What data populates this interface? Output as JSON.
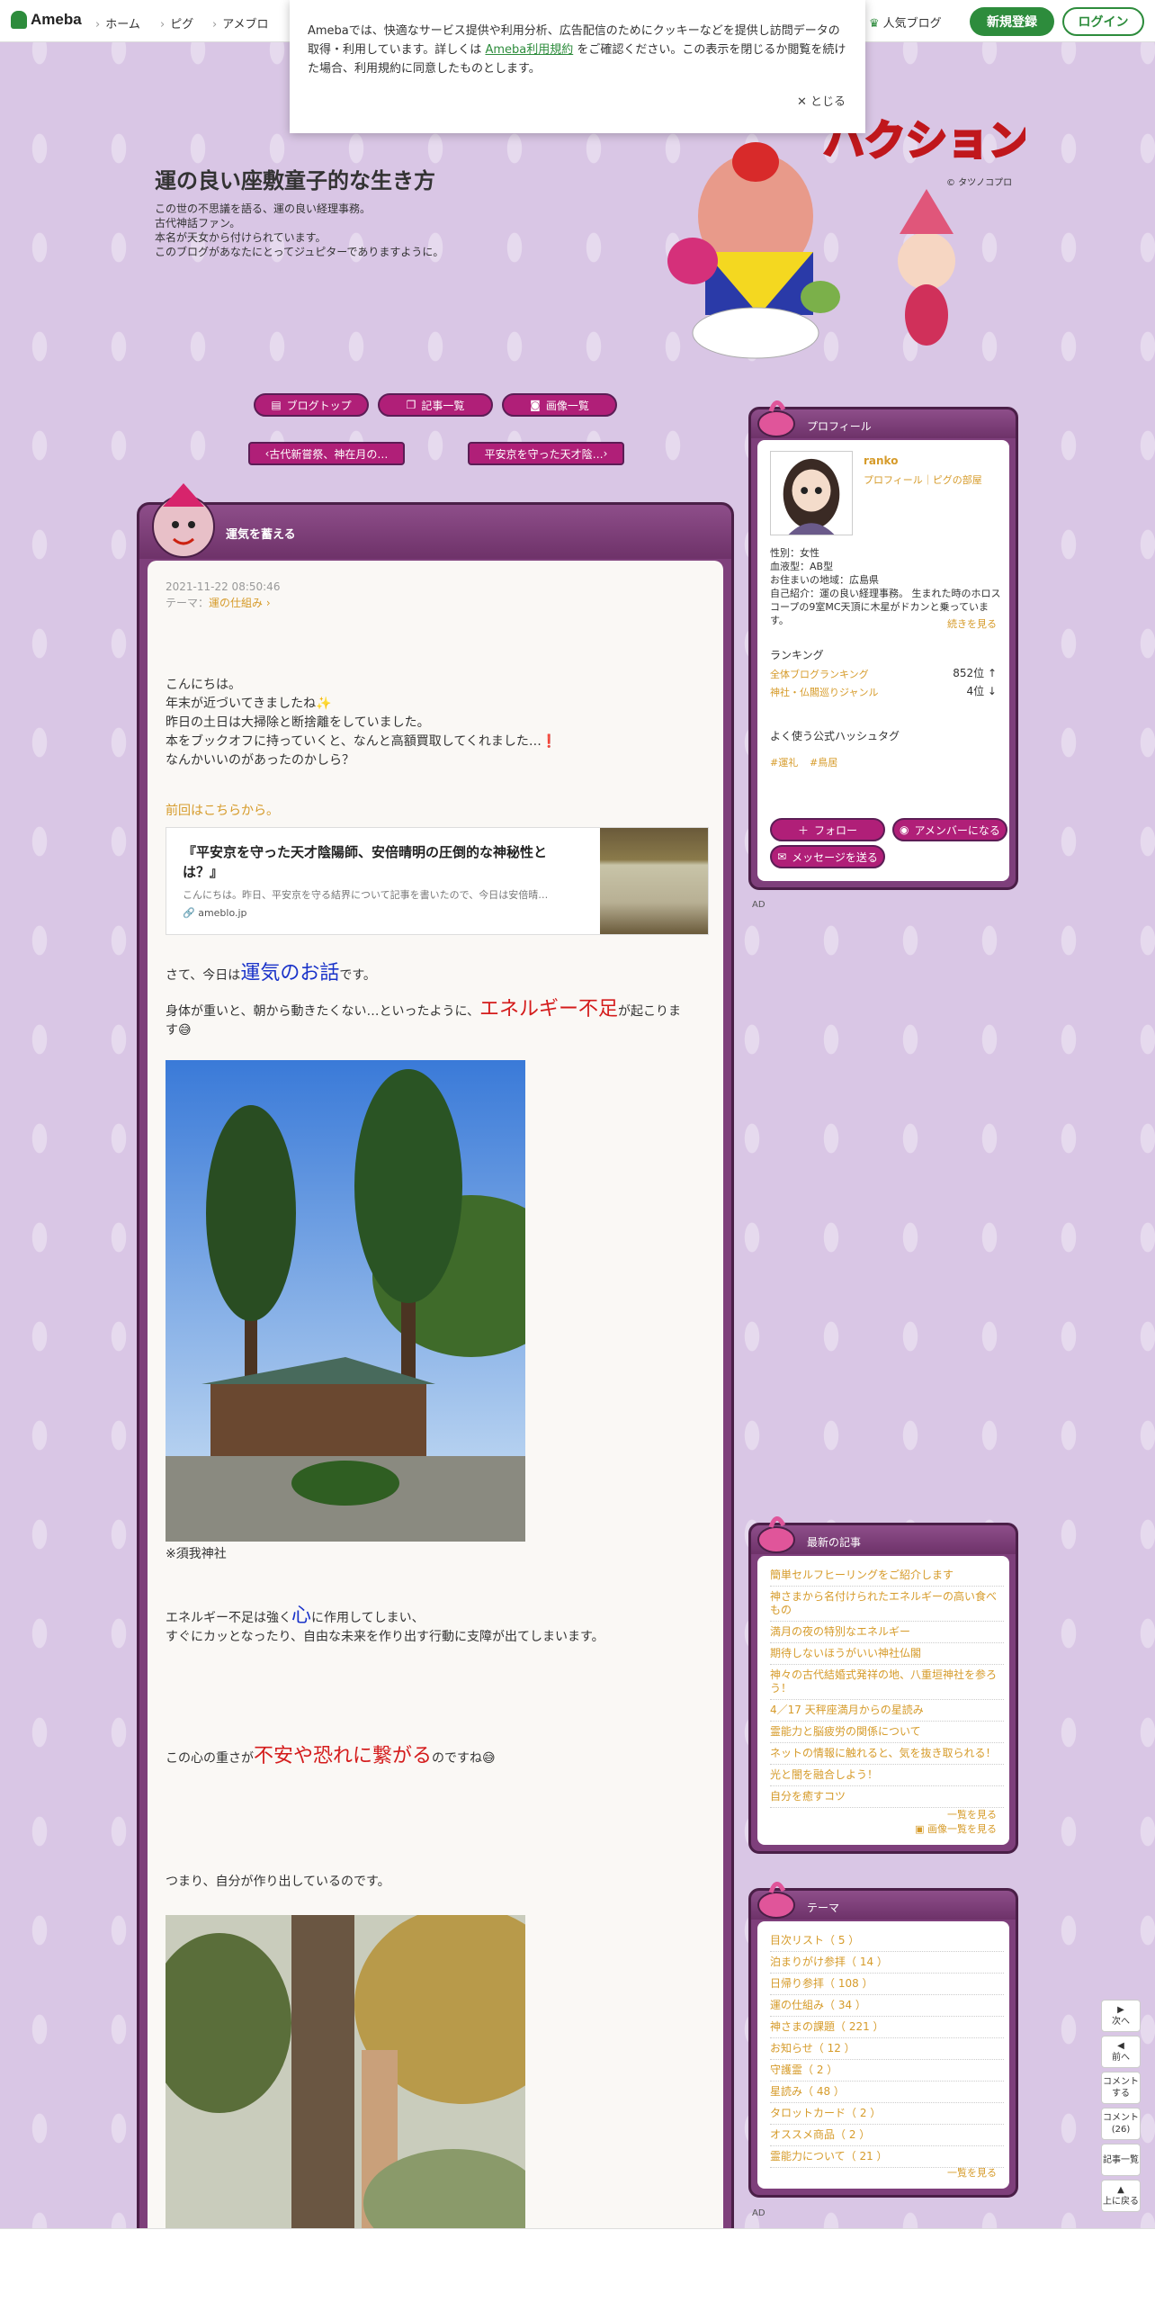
{
  "topnav": {
    "logo": "Ameba",
    "items": [
      "ホーム",
      "ピグ",
      "アメブロ"
    ],
    "popular": "人気ブログ",
    "register": "新規登録",
    "login": "ログイン"
  },
  "cookie": {
    "text_before": "Amebaでは、快適なサービス提供や利用分析、広告配信のためにクッキーなどを提供し訪問データの取得・利用しています。詳しくは ",
    "link": "Ameba利用規約",
    "text_after": " をご確認ください。この表示を閉じるか閲覧を続けた場合、利用規約に同意したものとします。",
    "close": "✕ とじる"
  },
  "header": {
    "title": "運の良い座敷童子的な生き方",
    "desc": [
      "この世の不思議を語る、運の良い経理事務。",
      "古代神話ファン。",
      "本名が天女から付けられています。",
      "このブログがあなたにとってジュピターでありますように。"
    ],
    "art_title": "ハクション大魔王",
    "credit": "© タツノコプロ"
  },
  "mainnav": {
    "top": "ブログトップ",
    "list": "記事一覧",
    "images": "画像一覧",
    "prev": "古代新嘗祭、神在月の…",
    "next": "平安京を守った天才陰…"
  },
  "article": {
    "title": "運気を蓄える",
    "date": "2021-11-22 08:50:46",
    "theme_label": "テーマ：",
    "theme": "運の仕組み",
    "p1": [
      "こんにちは。",
      "年末が近づいてきましたね✨",
      "昨日の土日は大掃除と断捨離をしていました。",
      "本をブックオフに持っていくと、なんと高額買取してくれました…❗",
      "なんかいいのがあったのかしら？"
    ],
    "prev_link": "前回はこちらから。",
    "card_title": "『平安京を守った天才陰陽師、安倍晴明の圧倒的な神秘性とは？』",
    "card_excerpt": "こんにちは。昨日、平安京を守る結界について記事を書いたので、今日は安倍晴…",
    "card_domain": "ameblo.jp",
    "s1_pre": "さて、今日は",
    "s1_big": "運気のお話",
    "s1_post": "です。",
    "s2_pre": "身体が重いと、朝から動きたくない…といったように、",
    "s2_big": "エネルギー不足",
    "s2_post": "が起こりま",
    "s2_line2": "す😅",
    "caption1": "※須我神社",
    "s3_pre": "エネルギー不足は強く",
    "s3_big": "心",
    "s3_post": "に作用してしまい、",
    "s3_line2": "すぐにカッとなったり、自由な未来を作り出す行動に支障が出てしまいます。",
    "s4_pre": "この心の重さが",
    "s4_big": "不安や恐れに繋がる",
    "s4_post": "のですね😅",
    "s5": "つまり、自分が作り出しているのです。"
  },
  "profile": {
    "head": "プロフィール",
    "name": "ranko",
    "links": "プロフィール｜ピグの部屋",
    "details": [
      "性別：女性",
      "血液型：AB型",
      "お住まいの地域：広島県",
      "自己紹介：運の良い経理事務。 生まれた時のホロスコープの9室MC天頂に木星がドカンと乗っていま",
      "す。"
    ],
    "more": "続きを見る",
    "ranking_head": "ランキング",
    "rank1_label": "全体ブログランキング",
    "rank1_value": "852位 ↑",
    "rank2_label": "神社・仏閣巡りジャンル",
    "rank2_value": "4位 ↓",
    "hashtag_head": "よく使う公式ハッシュタグ",
    "hashtags": [
      "#運礼",
      "#鳥居"
    ],
    "follow": "フォロー",
    "member": "アメンバーになる",
    "message": "メッセージを送る"
  },
  "ad_label": "AD",
  "recent": {
    "head": "最新の記事",
    "items": [
      "簡単セルフヒーリングをご紹介します",
      "神さまから名付けられたエネルギーの高い食べもの",
      "満月の夜の特別なエネルギー",
      "期待しないほうがいい神社仏閣",
      "神々の古代結婚式発祥の地、八重垣神社を参ろう！",
      "4／17 天秤座満月からの星読み",
      "霊能力と脳疲労の関係について",
      "ネットの情報に触れると、気を抜き取られる！",
      "光と闇を融合しよう！",
      "自分を癒すコツ"
    ],
    "more": "一覧を見る",
    "images": "画像一覧を見る"
  },
  "themes": {
    "head": "テーマ",
    "items": [
      "目次リスト（ 5 ）",
      "泊まりがけ参拝（ 14 ）",
      "日帰り参拝（ 108 ）",
      "運の仕組み（ 34 ）",
      "神さまの課題（ 221 ）",
      "お知らせ（ 12 ）",
      "守護霊（ 2 ）",
      "星読み（ 48 ）",
      "タロットカード（ 2 ）",
      "オススメ商品（ 2 ）",
      "霊能力について（ 21 ）"
    ],
    "more": "一覧を見る"
  },
  "float": {
    "next": "次へ",
    "prev": "前へ",
    "comment": "コメントする",
    "comment_count": "コメント(26)",
    "list": "記事一覧",
    "top": "上に戻る"
  }
}
